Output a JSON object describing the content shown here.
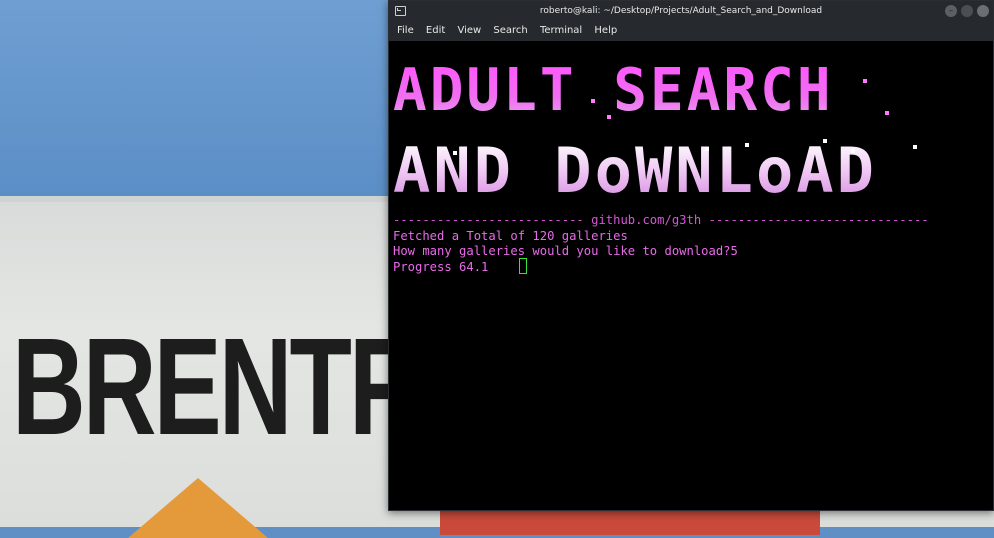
{
  "window": {
    "title": "roberto@kali: ~/Desktop/Projects/Adult_Search_and_Download"
  },
  "menu": [
    "File",
    "Edit",
    "View",
    "Search",
    "Terminal",
    "Help"
  ],
  "banner": {
    "line1": "ADULT SEARCH",
    "line2": "AND DoWNLoAD"
  },
  "terminal": {
    "divider": "-------------------------- github.com/g3th ------------------------------",
    "lines": [
      "Fetched a Total of 120 galleries",
      "How many galleries would you like to download?5",
      "Progress 64.1"
    ]
  },
  "wallpaper": {
    "sign_text": "BRENTF"
  },
  "colors": {
    "terminal_bg": "#000000",
    "text_magenta": "#e86be8",
    "cursor_green": "#39e239",
    "titlebar": "#262a2e"
  }
}
